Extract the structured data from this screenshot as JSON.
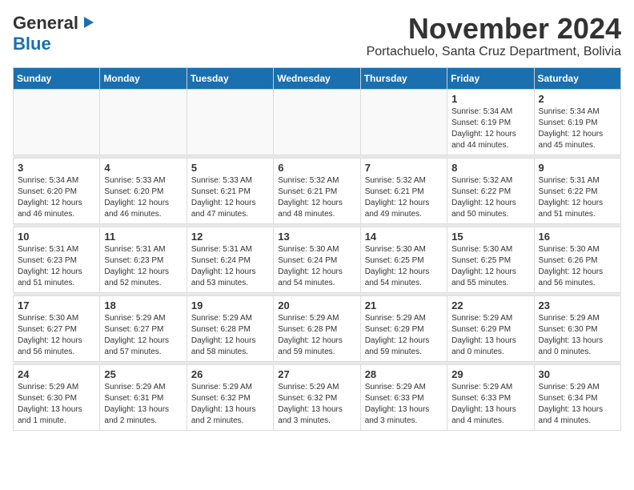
{
  "header": {
    "logo_line1": "General",
    "logo_line2": "Blue",
    "title": "November 2024",
    "subtitle": "Portachuelo, Santa Cruz Department, Bolivia"
  },
  "weekdays": [
    "Sunday",
    "Monday",
    "Tuesday",
    "Wednesday",
    "Thursday",
    "Friday",
    "Saturday"
  ],
  "weeks": [
    [
      {
        "day": "",
        "info": ""
      },
      {
        "day": "",
        "info": ""
      },
      {
        "day": "",
        "info": ""
      },
      {
        "day": "",
        "info": ""
      },
      {
        "day": "",
        "info": ""
      },
      {
        "day": "1",
        "info": "Sunrise: 5:34 AM\nSunset: 6:19 PM\nDaylight: 12 hours\nand 44 minutes."
      },
      {
        "day": "2",
        "info": "Sunrise: 5:34 AM\nSunset: 6:19 PM\nDaylight: 12 hours\nand 45 minutes."
      }
    ],
    [
      {
        "day": "3",
        "info": "Sunrise: 5:34 AM\nSunset: 6:20 PM\nDaylight: 12 hours\nand 46 minutes."
      },
      {
        "day": "4",
        "info": "Sunrise: 5:33 AM\nSunset: 6:20 PM\nDaylight: 12 hours\nand 46 minutes."
      },
      {
        "day": "5",
        "info": "Sunrise: 5:33 AM\nSunset: 6:21 PM\nDaylight: 12 hours\nand 47 minutes."
      },
      {
        "day": "6",
        "info": "Sunrise: 5:32 AM\nSunset: 6:21 PM\nDaylight: 12 hours\nand 48 minutes."
      },
      {
        "day": "7",
        "info": "Sunrise: 5:32 AM\nSunset: 6:21 PM\nDaylight: 12 hours\nand 49 minutes."
      },
      {
        "day": "8",
        "info": "Sunrise: 5:32 AM\nSunset: 6:22 PM\nDaylight: 12 hours\nand 50 minutes."
      },
      {
        "day": "9",
        "info": "Sunrise: 5:31 AM\nSunset: 6:22 PM\nDaylight: 12 hours\nand 51 minutes."
      }
    ],
    [
      {
        "day": "10",
        "info": "Sunrise: 5:31 AM\nSunset: 6:23 PM\nDaylight: 12 hours\nand 51 minutes."
      },
      {
        "day": "11",
        "info": "Sunrise: 5:31 AM\nSunset: 6:23 PM\nDaylight: 12 hours\nand 52 minutes."
      },
      {
        "day": "12",
        "info": "Sunrise: 5:31 AM\nSunset: 6:24 PM\nDaylight: 12 hours\nand 53 minutes."
      },
      {
        "day": "13",
        "info": "Sunrise: 5:30 AM\nSunset: 6:24 PM\nDaylight: 12 hours\nand 54 minutes."
      },
      {
        "day": "14",
        "info": "Sunrise: 5:30 AM\nSunset: 6:25 PM\nDaylight: 12 hours\nand 54 minutes."
      },
      {
        "day": "15",
        "info": "Sunrise: 5:30 AM\nSunset: 6:25 PM\nDaylight: 12 hours\nand 55 minutes."
      },
      {
        "day": "16",
        "info": "Sunrise: 5:30 AM\nSunset: 6:26 PM\nDaylight: 12 hours\nand 56 minutes."
      }
    ],
    [
      {
        "day": "17",
        "info": "Sunrise: 5:30 AM\nSunset: 6:27 PM\nDaylight: 12 hours\nand 56 minutes."
      },
      {
        "day": "18",
        "info": "Sunrise: 5:29 AM\nSunset: 6:27 PM\nDaylight: 12 hours\nand 57 minutes."
      },
      {
        "day": "19",
        "info": "Sunrise: 5:29 AM\nSunset: 6:28 PM\nDaylight: 12 hours\nand 58 minutes."
      },
      {
        "day": "20",
        "info": "Sunrise: 5:29 AM\nSunset: 6:28 PM\nDaylight: 12 hours\nand 59 minutes."
      },
      {
        "day": "21",
        "info": "Sunrise: 5:29 AM\nSunset: 6:29 PM\nDaylight: 12 hours\nand 59 minutes."
      },
      {
        "day": "22",
        "info": "Sunrise: 5:29 AM\nSunset: 6:29 PM\nDaylight: 13 hours\nand 0 minutes."
      },
      {
        "day": "23",
        "info": "Sunrise: 5:29 AM\nSunset: 6:30 PM\nDaylight: 13 hours\nand 0 minutes."
      }
    ],
    [
      {
        "day": "24",
        "info": "Sunrise: 5:29 AM\nSunset: 6:30 PM\nDaylight: 13 hours\nand 1 minute."
      },
      {
        "day": "25",
        "info": "Sunrise: 5:29 AM\nSunset: 6:31 PM\nDaylight: 13 hours\nand 2 minutes."
      },
      {
        "day": "26",
        "info": "Sunrise: 5:29 AM\nSunset: 6:32 PM\nDaylight: 13 hours\nand 2 minutes."
      },
      {
        "day": "27",
        "info": "Sunrise: 5:29 AM\nSunset: 6:32 PM\nDaylight: 13 hours\nand 3 minutes."
      },
      {
        "day": "28",
        "info": "Sunrise: 5:29 AM\nSunset: 6:33 PM\nDaylight: 13 hours\nand 3 minutes."
      },
      {
        "day": "29",
        "info": "Sunrise: 5:29 AM\nSunset: 6:33 PM\nDaylight: 13 hours\nand 4 minutes."
      },
      {
        "day": "30",
        "info": "Sunrise: 5:29 AM\nSunset: 6:34 PM\nDaylight: 13 hours\nand 4 minutes."
      }
    ]
  ]
}
